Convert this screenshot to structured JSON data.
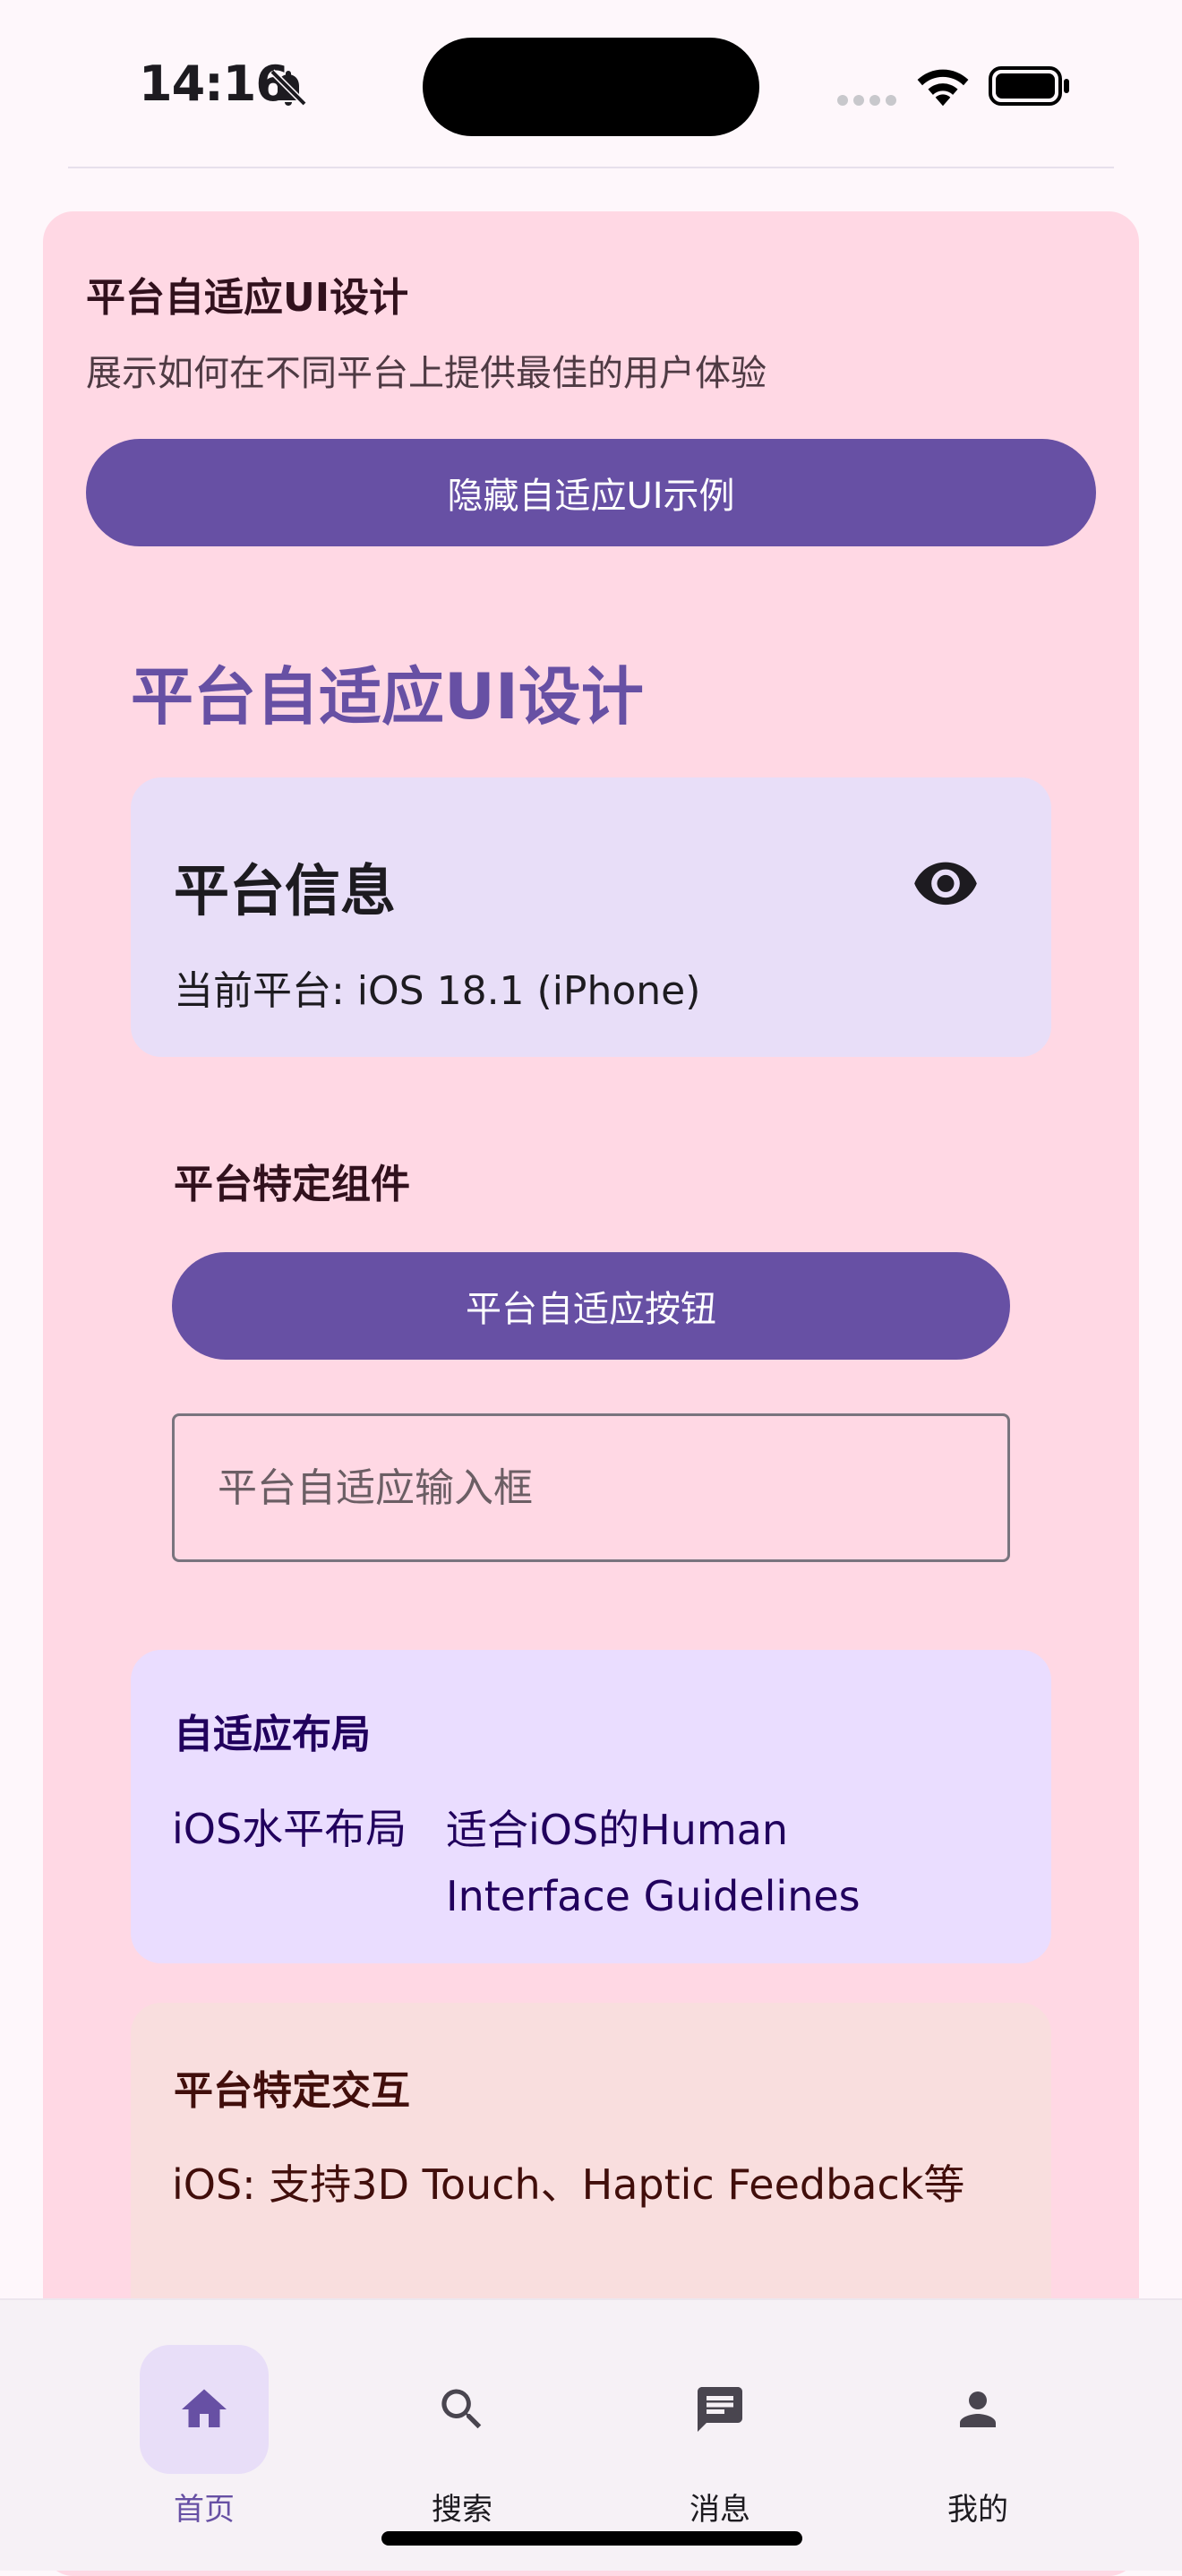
{
  "status_bar": {
    "time": "14:16"
  },
  "header": {
    "title": "平台自适应UI设计",
    "subtitle": "展示如何在不同平台上提供最佳的用户体验",
    "toggle_button_label": "隐藏自适应UI示例"
  },
  "demo": {
    "title": "平台自适应UI设计",
    "platform_info": {
      "title": "平台信息",
      "text": "当前平台: iOS 18.1 (iPhone)",
      "icon": "eye-icon"
    },
    "components": {
      "title": "平台特定组件",
      "button_label": "平台自适应按钮",
      "input_placeholder": "平台自适应输入框",
      "input_value": ""
    },
    "layout": {
      "title": "自适应布局",
      "left": "iOS水平布局",
      "right": "适合iOS的Human Interface Guidelines"
    },
    "interaction": {
      "title": "平台特定交互",
      "text": "iOS: 支持3D Touch、Haptic Feedback等"
    }
  },
  "bottom_nav": {
    "items": [
      {
        "label": "首页",
        "icon": "home-icon",
        "active": true
      },
      {
        "label": "搜索",
        "icon": "search-icon",
        "active": false
      },
      {
        "label": "消息",
        "icon": "message-icon",
        "active": false
      },
      {
        "label": "我的",
        "icon": "person-icon",
        "active": false
      }
    ]
  },
  "colors": {
    "primary": "#6750a4",
    "card_pink": "#ffd8e4",
    "card_lavender": "#e8def8",
    "card_violet": "#eaddff",
    "card_peach": "#f9dede"
  }
}
